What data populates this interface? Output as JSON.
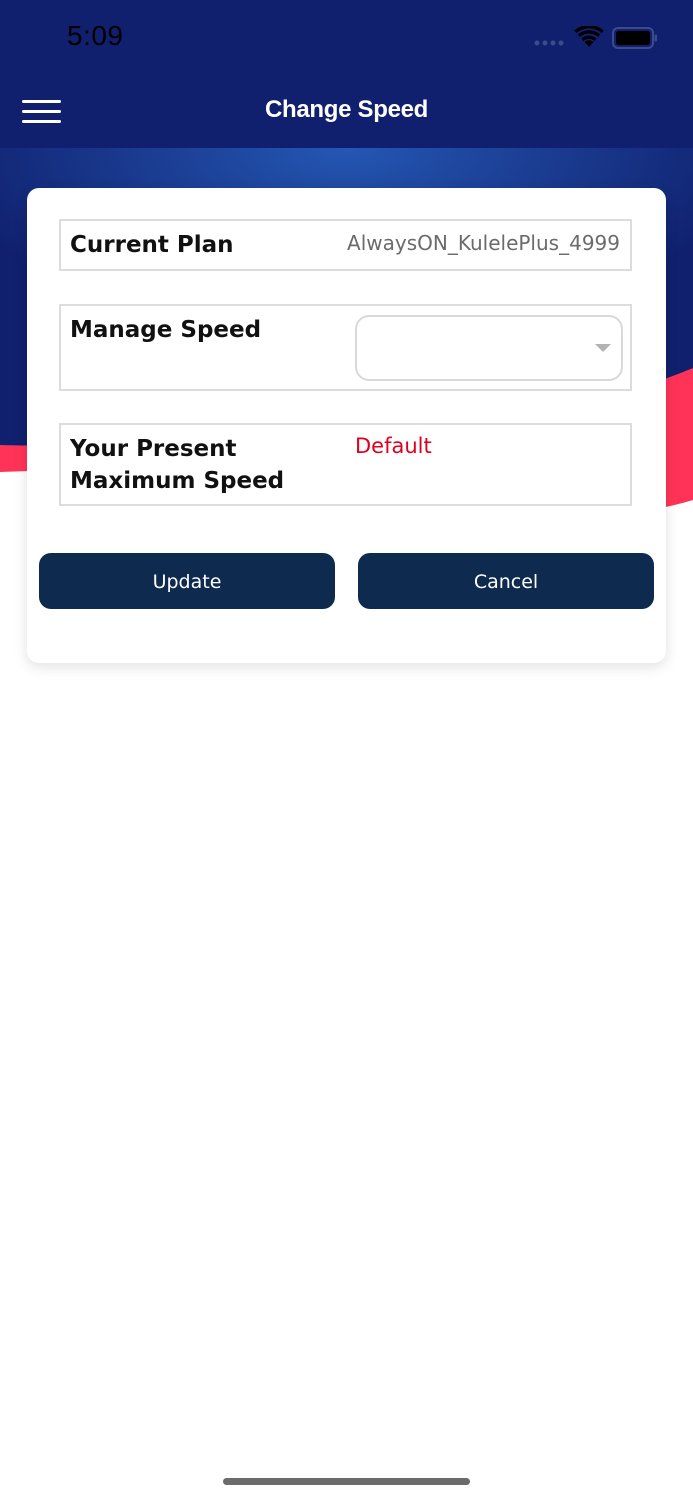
{
  "status_bar": {
    "time": "5:09"
  },
  "nav": {
    "title": "Change Speed",
    "menu_icon": "hamburger-menu-icon"
  },
  "form": {
    "current_plan": {
      "label": "Current Plan",
      "value": "AlwaysON_KulelePlus_4999"
    },
    "manage_speed": {
      "label": "Manage Speed",
      "selected": ""
    },
    "max_speed": {
      "label_line1": "Your Present",
      "label_line2": "Maximum Speed",
      "value": "Default"
    }
  },
  "actions": {
    "update_label": "Update",
    "cancel_label": "Cancel"
  },
  "colors": {
    "nav_background": "#10206e",
    "accent_red": "#ff3358",
    "button_background": "#0e2a4e",
    "value_red": "#e0001b"
  }
}
